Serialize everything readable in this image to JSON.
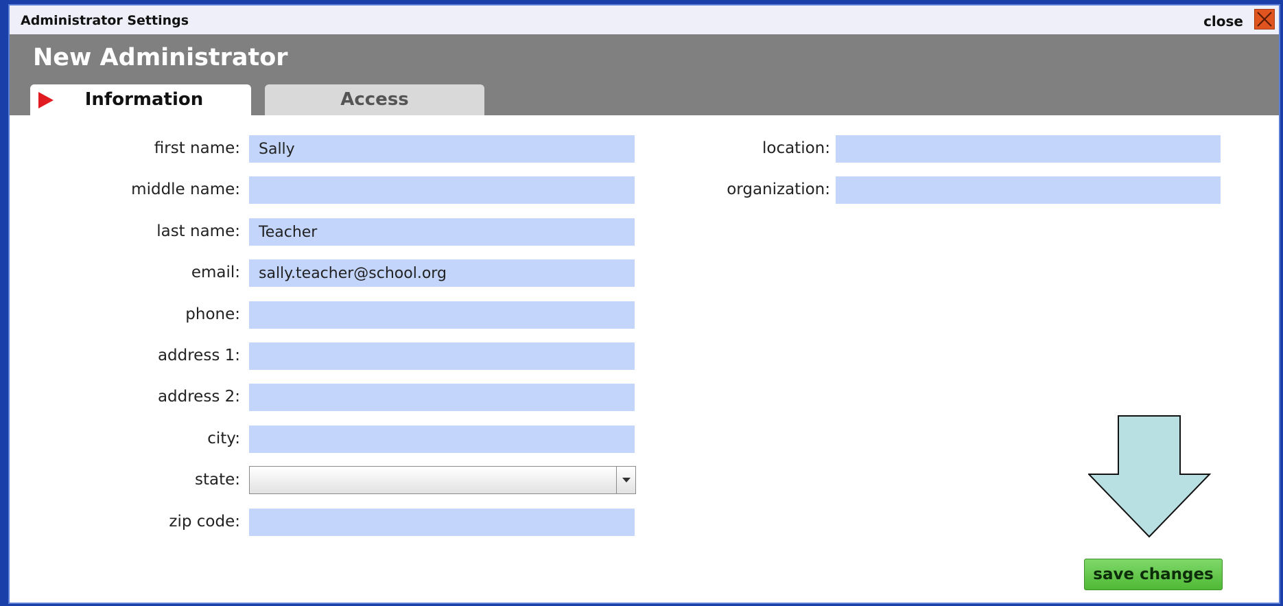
{
  "window": {
    "title": "Administrator Settings",
    "close_label": "close"
  },
  "header": {
    "title": "New Administrator"
  },
  "tabs": [
    {
      "label": "Information",
      "active": true
    },
    {
      "label": "Access",
      "active": false
    }
  ],
  "form": {
    "left_fields": [
      {
        "label": "first name:",
        "value": ""
      },
      {
        "label": "middle name:",
        "value": ""
      },
      {
        "label": "last name:",
        "value": ""
      },
      {
        "label": "email:",
        "value": ""
      },
      {
        "label": "phone:",
        "value": ""
      },
      {
        "label": "address 1:",
        "value": ""
      },
      {
        "label": "address 2:",
        "value": ""
      },
      {
        "label": "city:",
        "value": ""
      },
      {
        "label": "state:",
        "value": ""
      },
      {
        "label": "zip code:",
        "value": ""
      }
    ],
    "right_fields": [
      {
        "label": "location:",
        "value": ""
      },
      {
        "label": "organization:",
        "value": ""
      }
    ],
    "values": {
      "first_name": "Sally",
      "middle_name": "",
      "last_name": "Teacher",
      "email": "sally.teacher@school.org",
      "phone": "",
      "address1": "",
      "address2": "",
      "city": "",
      "state": "",
      "zip": "",
      "location": "",
      "organization": ""
    }
  },
  "actions": {
    "save_label": "save changes"
  },
  "colors": {
    "desktop": "#1a3fa8",
    "header": "#808080",
    "input_fill": "#c3d5fb",
    "save_button": "#5cc43f",
    "hint_arrow": "#b8e0e3",
    "tab_marker": "#e11b22",
    "close_icon": "#e0541f"
  },
  "icons": {
    "close": "close-icon",
    "tab_marker": "play-arrow-icon",
    "dropdown": "chevron-down-icon",
    "hint": "down-arrow-icon"
  }
}
